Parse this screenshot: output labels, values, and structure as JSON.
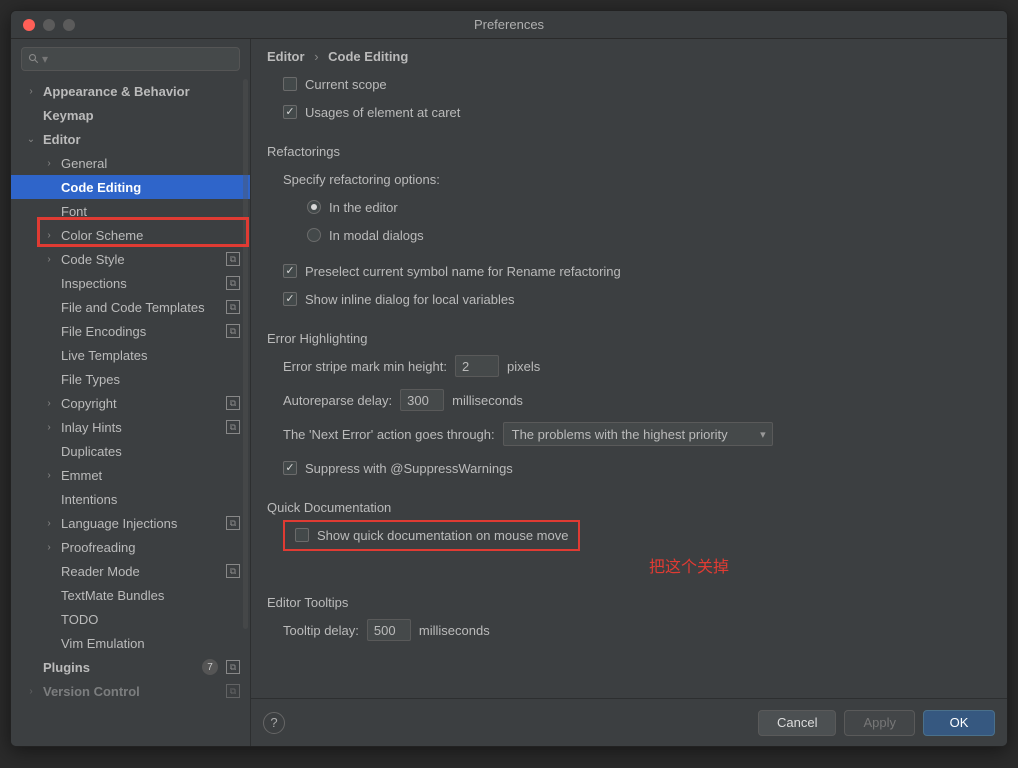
{
  "window": {
    "title": "Preferences"
  },
  "breadcrumb": {
    "parent": "Editor",
    "current": "Code Editing"
  },
  "sidebar": {
    "items": [
      {
        "label": "Appearance & Behavior",
        "indent": 0,
        "arrow": "right",
        "bold": true
      },
      {
        "label": "Keymap",
        "indent": 0,
        "arrow": "",
        "bold": true
      },
      {
        "label": "Editor",
        "indent": 0,
        "arrow": "down",
        "bold": true
      },
      {
        "label": "General",
        "indent": 1,
        "arrow": "right"
      },
      {
        "label": "Code Editing",
        "indent": 1,
        "arrow": "",
        "selected": true,
        "bold": true
      },
      {
        "label": "Font",
        "indent": 1,
        "arrow": ""
      },
      {
        "label": "Color Scheme",
        "indent": 1,
        "arrow": "right"
      },
      {
        "label": "Code Style",
        "indent": 1,
        "arrow": "right",
        "icon": "project"
      },
      {
        "label": "Inspections",
        "indent": 1,
        "arrow": "",
        "icon": "project"
      },
      {
        "label": "File and Code Templates",
        "indent": 1,
        "arrow": "",
        "icon": "project"
      },
      {
        "label": "File Encodings",
        "indent": 1,
        "arrow": "",
        "icon": "project"
      },
      {
        "label": "Live Templates",
        "indent": 1,
        "arrow": ""
      },
      {
        "label": "File Types",
        "indent": 1,
        "arrow": ""
      },
      {
        "label": "Copyright",
        "indent": 1,
        "arrow": "right",
        "icon": "project"
      },
      {
        "label": "Inlay Hints",
        "indent": 1,
        "arrow": "right",
        "icon": "project"
      },
      {
        "label": "Duplicates",
        "indent": 1,
        "arrow": ""
      },
      {
        "label": "Emmet",
        "indent": 1,
        "arrow": "right"
      },
      {
        "label": "Intentions",
        "indent": 1,
        "arrow": ""
      },
      {
        "label": "Language Injections",
        "indent": 1,
        "arrow": "right",
        "icon": "project"
      },
      {
        "label": "Proofreading",
        "indent": 1,
        "arrow": "right"
      },
      {
        "label": "Reader Mode",
        "indent": 1,
        "arrow": "",
        "icon": "project"
      },
      {
        "label": "TextMate Bundles",
        "indent": 1,
        "arrow": ""
      },
      {
        "label": "TODO",
        "indent": 1,
        "arrow": ""
      },
      {
        "label": "Vim Emulation",
        "indent": 1,
        "arrow": ""
      },
      {
        "label": "Plugins",
        "indent": 0,
        "arrow": "",
        "bold": true,
        "count": "7",
        "icon": "project"
      },
      {
        "label": "Version Control",
        "indent": 0,
        "arrow": "right",
        "bold": true,
        "icon": "project",
        "faded": true
      }
    ]
  },
  "main": {
    "current_scope": {
      "label": "Current scope",
      "checked": false
    },
    "usages_at_caret": {
      "label": "Usages of element at caret",
      "checked": true
    },
    "refactorings": {
      "title": "Refactorings",
      "specify_label": "Specify refactoring options:",
      "in_editor": {
        "label": "In the editor",
        "checked": true
      },
      "in_modal": {
        "label": "In modal dialogs",
        "checked": false
      },
      "preselect": {
        "label": "Preselect current symbol name for Rename refactoring",
        "checked": true
      },
      "inline_dialog": {
        "label": "Show inline dialog for local variables",
        "checked": true
      }
    },
    "error_highlighting": {
      "title": "Error Highlighting",
      "stripe_label": "Error stripe mark min height:",
      "stripe_value": "2",
      "stripe_unit": "pixels",
      "autoreparse_label": "Autoreparse delay:",
      "autoreparse_value": "300",
      "autoreparse_unit": "milliseconds",
      "next_error_label": "The 'Next Error' action goes through:",
      "next_error_value": "The problems with the highest priority",
      "suppress": {
        "label": "Suppress with @SuppressWarnings",
        "checked": true
      }
    },
    "quick_doc": {
      "title": "Quick Documentation",
      "show_on_move": {
        "label": "Show quick documentation on mouse move",
        "checked": false
      }
    },
    "annotation": "把这个关掉",
    "tooltips": {
      "title": "Editor Tooltips",
      "delay_label": "Tooltip delay:",
      "delay_value": "500",
      "delay_unit": "milliseconds"
    }
  },
  "footer": {
    "cancel": "Cancel",
    "apply": "Apply",
    "ok": "OK"
  }
}
